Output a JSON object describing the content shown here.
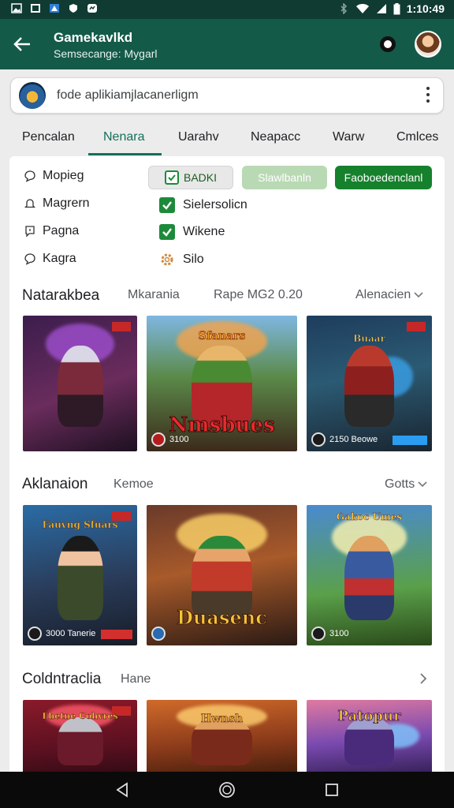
{
  "status_bar": {
    "time": "1:10:49"
  },
  "app_bar": {
    "title": "Gamekavlkd",
    "subtitle": "Semsecange: Mygarl"
  },
  "search": {
    "value": "fode aplikiamjlacanerligm"
  },
  "tabs": [
    {
      "label": "Pencalan"
    },
    {
      "label": "Nenara"
    },
    {
      "label": "Uarahv"
    },
    {
      "label": "Neapacc"
    },
    {
      "label": "Warw"
    },
    {
      "label": "Cmlces"
    }
  ],
  "filters": {
    "left": [
      {
        "label": "Mopieg",
        "icon": "chat-bubble-icon"
      },
      {
        "label": "Magrern",
        "icon": "bell-icon"
      },
      {
        "label": "Pagna",
        "icon": "info-bubble-icon"
      },
      {
        "label": "Kagra",
        "icon": "chat-bubble-icon"
      }
    ],
    "checks": [
      {
        "label": "Sielersolicn",
        "checked": true
      },
      {
        "label": "Wikene",
        "checked": true
      },
      {
        "label": "Silo",
        "icon": "gear-icon"
      }
    ],
    "chips": [
      "BADKI",
      "Slawlbanln",
      "Faoboedenclanl"
    ]
  },
  "sections": [
    {
      "title": "Natarakbea",
      "meta1": "Mkarania",
      "meta2": "Rape MG2 0.20",
      "link": "Alenacien"
    },
    {
      "title": "Aklanaion",
      "meta1": "Kemoe",
      "link": "Gotts"
    },
    {
      "title": "Coldntraclia",
      "meta1": "Hane"
    }
  ],
  "cards": [
    {
      "logo": "",
      "sub": ""
    },
    {
      "logo": "Nmsbues",
      "sub": "3100",
      "top": "Sfanars"
    },
    {
      "logo": "Buaar",
      "sub": "2150 Beowe"
    },
    {
      "logo": "Fauvng Sfuars",
      "sub": "3000 Tanerie"
    },
    {
      "logo": "Duasenc",
      "sub": ""
    },
    {
      "logo": "Gakoc Umes",
      "sub": "3100"
    },
    {
      "logo": "Fhetne Cohvres",
      "sub": ""
    },
    {
      "logo": "Hwnsh",
      "sub": ""
    },
    {
      "logo": "Patopur",
      "sub": ""
    }
  ],
  "colors": {
    "primary": "#145a48",
    "accent": "#14705a",
    "green": "#16812d"
  }
}
